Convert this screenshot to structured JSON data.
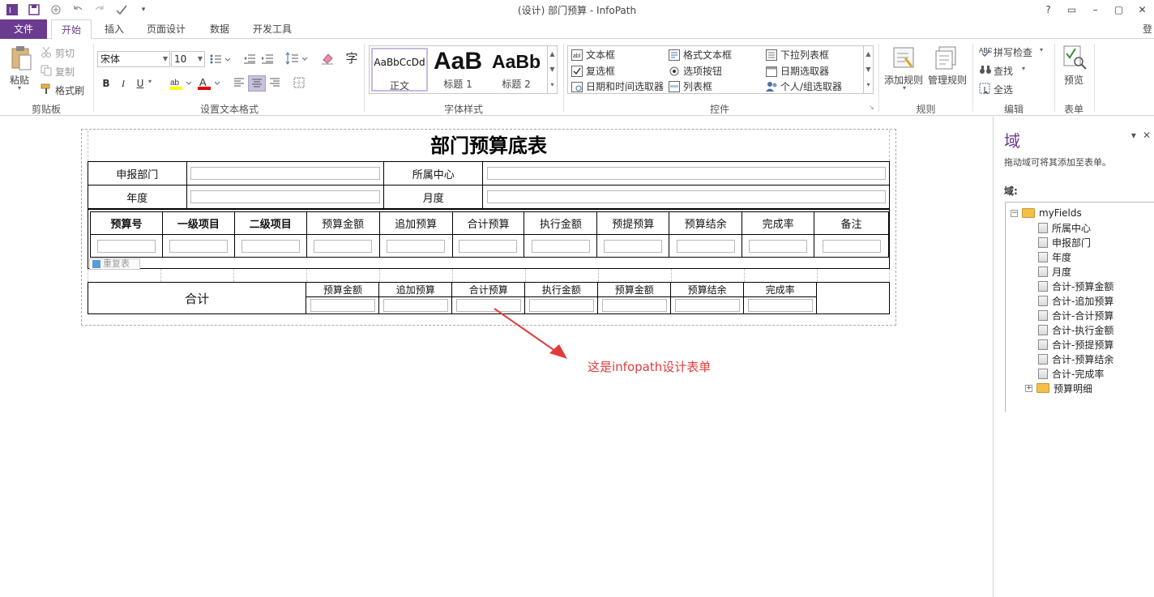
{
  "window": {
    "title": "(设计) 部门预算 - InfoPath",
    "controls": [
      "?",
      "▭",
      "–",
      "▢",
      "✕"
    ],
    "signin": "登"
  },
  "tabs": [
    "文件",
    "开始",
    "插入",
    "页面设计",
    "数据",
    "开发工具"
  ],
  "ribbon": {
    "clipboard": {
      "label": "剪贴板",
      "paste": "粘贴",
      "cut": "剪切",
      "copy": "复制",
      "format_painter": "格式刷"
    },
    "text_format": {
      "label": "设置文本格式",
      "font": "宋体",
      "size": "10",
      "bold": "B",
      "italic": "I",
      "underline": "U",
      "char_button": "字"
    },
    "styles": {
      "label": "字体样式",
      "items": [
        {
          "sample": "AaBbCcDd",
          "name": "正文"
        },
        {
          "sample": "AaB",
          "name": "标题 1"
        },
        {
          "sample": "AaBb",
          "name": "标题 2"
        }
      ]
    },
    "controls": {
      "label": "控件",
      "items": [
        "文本框",
        "格式文本框",
        "下拉列表框",
        "复选框",
        "选项按钮",
        "日期选取器",
        "日期和时间选取器",
        "列表框",
        "个人/组选取器"
      ]
    },
    "rules": {
      "label": "规则",
      "add": "添加规则",
      "manage": "管理规则"
    },
    "editing": {
      "label": "编辑",
      "spell": "拼写检查",
      "find": "查找",
      "select_all": "全选"
    },
    "form": {
      "label": "表单",
      "preview": "预览"
    }
  },
  "form": {
    "title": "部门预算底表",
    "header_rows": [
      {
        "label1": "申报部门",
        "label2": "所属中心"
      },
      {
        "label1": "年度",
        "label2": "月度"
      }
    ],
    "detail_columns": [
      "预算号",
      "一级项目",
      "二级项目",
      "预算金额",
      "追加预算",
      "合计预算",
      "执行金额",
      "预提预算",
      "预算结余",
      "完成率",
      "备注"
    ],
    "repeat_tag": "重复表",
    "total_label": "合计",
    "total_columns": [
      "预算金额",
      "追加预算",
      "合计预算",
      "执行金额",
      "预算金额",
      "预算结余",
      "完成率"
    ]
  },
  "annotation": "这是infopath设计表单",
  "annotation_color": "#e33b3b",
  "task_pane": {
    "title": "域",
    "hint": "拖动域可将其添加至表单。",
    "fields_label": "域:",
    "root": "myFields",
    "fields": [
      "所属中心",
      "申报部门",
      "年度",
      "月度",
      "合计-预算金额",
      "合计-追加预算",
      "合计-合计预算",
      "合计-执行金额",
      "合计-预提预算",
      "合计-预算结余",
      "合计-完成率"
    ],
    "group": "预算明细"
  },
  "accent_color": "#6a3b8f"
}
